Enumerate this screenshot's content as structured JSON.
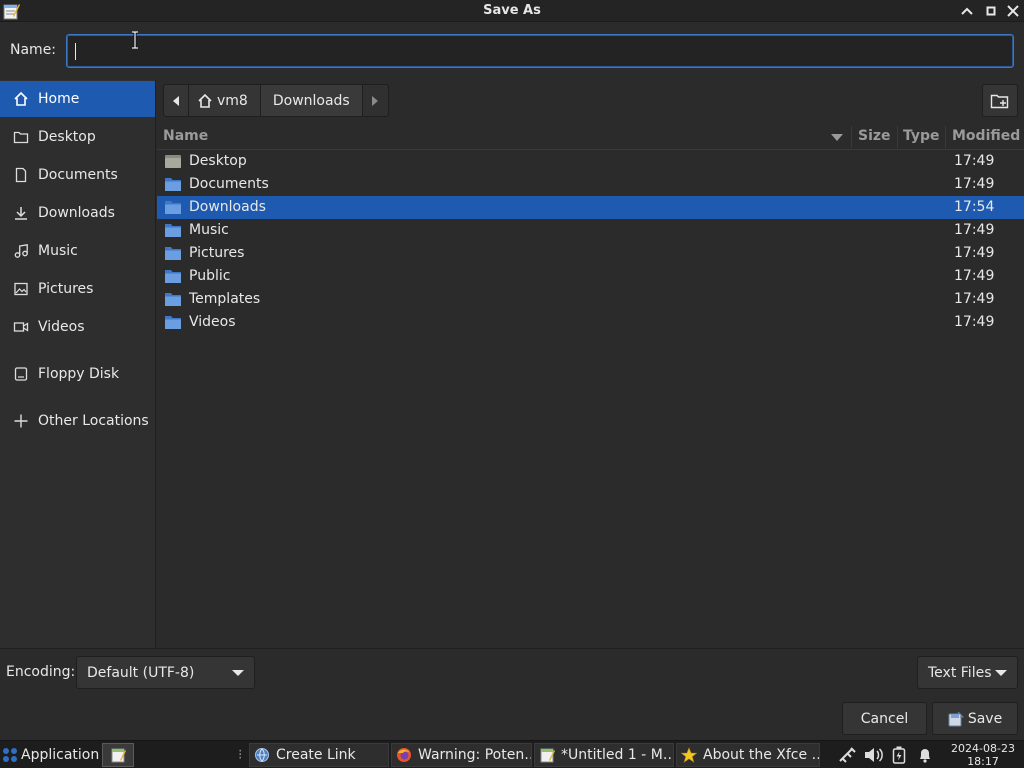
{
  "window": {
    "title": "Save As"
  },
  "name_field": {
    "label": "Name:",
    "value": ""
  },
  "sidebar": {
    "items": [
      {
        "label": "Home",
        "icon": "home-icon",
        "active": true
      },
      {
        "label": "Desktop",
        "icon": "folder-icon"
      },
      {
        "label": "Documents",
        "icon": "document-icon"
      },
      {
        "label": "Downloads",
        "icon": "download-icon"
      },
      {
        "label": "Music",
        "icon": "music-icon"
      },
      {
        "label": "Pictures",
        "icon": "picture-icon"
      },
      {
        "label": "Videos",
        "icon": "video-icon"
      },
      {
        "label": "Floppy Disk",
        "icon": "drive-icon"
      },
      {
        "label": "Other Locations",
        "icon": "plus-icon"
      }
    ]
  },
  "path": {
    "home": "vm8",
    "current": "Downloads"
  },
  "columns": {
    "name": "Name",
    "size": "Size",
    "type": "Type",
    "modified": "Modified"
  },
  "files": [
    {
      "name": "Desktop",
      "modified": "17:49"
    },
    {
      "name": "Documents",
      "modified": "17:49"
    },
    {
      "name": "Downloads",
      "modified": "17:54",
      "selected": true
    },
    {
      "name": "Music",
      "modified": "17:49"
    },
    {
      "name": "Pictures",
      "modified": "17:49"
    },
    {
      "name": "Public",
      "modified": "17:49"
    },
    {
      "name": "Templates",
      "modified": "17:49"
    },
    {
      "name": "Videos",
      "modified": "17:49"
    }
  ],
  "encoding": {
    "label": "Encoding:",
    "value": "Default (UTF-8)"
  },
  "filter": {
    "value": "Text Files"
  },
  "buttons": {
    "cancel": "Cancel",
    "save": "Save"
  },
  "taskbar": {
    "applications": "Applications",
    "tasks": [
      {
        "label": "Create Link",
        "icon": "web-icon"
      },
      {
        "label": "Warning: Poten…",
        "icon": "firefox-icon"
      },
      {
        "label": "*Untitled 1 - M…",
        "icon": "editor-icon"
      },
      {
        "label": "About the Xfce …",
        "icon": "star-icon"
      }
    ],
    "date": "2024-08-23",
    "time": "18:17"
  },
  "colors": {
    "accent": "#1e5bb0",
    "background": "#2b2b2b",
    "folder": "#5b8fd6"
  }
}
